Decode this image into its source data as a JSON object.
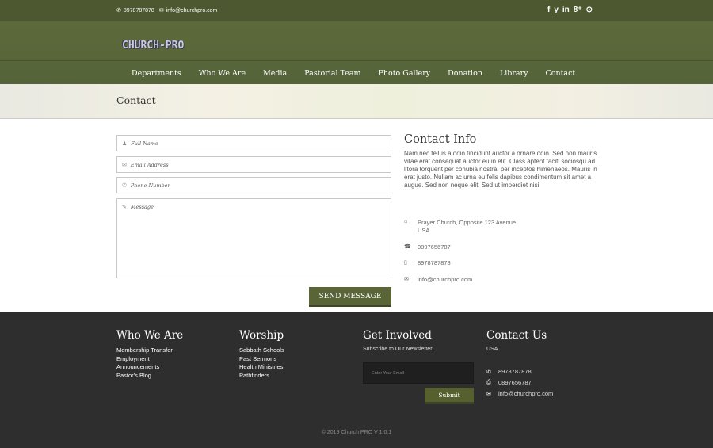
{
  "topbar": {
    "phone": "8978787878",
    "email": "info@churchpro.com",
    "social": [
      {
        "icon": "facebook-icon",
        "glyph": "f"
      },
      {
        "icon": "twitter-icon",
        "glyph": "🐦"
      },
      {
        "icon": "linkedin-icon",
        "glyph": "in"
      },
      {
        "icon": "google-plus-icon",
        "glyph": "g+"
      },
      {
        "icon": "pinterest-icon",
        "glyph": "℗"
      }
    ]
  },
  "header": {
    "logo_text": "CHURCH-PRO",
    "nav": [
      "Departments",
      "Who We Are",
      "Media",
      "Pastorial Team",
      "Photo Gallery",
      "Donation",
      "Library",
      "Contact"
    ]
  },
  "banner": {
    "title": "Contact"
  },
  "form": {
    "full_name_placeholder": "Full Name",
    "email_placeholder": "Email Address",
    "phone_placeholder": "Phone Number",
    "message_placeholder": "Message",
    "send_label": "SEND MESSAGE"
  },
  "contact_info": {
    "title": "Contact Info",
    "description": "Nam nec tellus a odio tincidunt auctor a ornare odio. Sed non mauris vitae erat consequat auctor eu in elit. Class aptent taciti sociosqu ad litora torquent per conubia nostra, per inceptos himenaeos. Mauris in erat justo. Nullam ac urna eu felis dapibus condimentum sit amet a augue. Sed non neque elit. Sed ut imperdiet nisi",
    "address_line1": "Prayer Church, Opposite 123 Avenue",
    "address_line2": "USA",
    "fax": "0897656787",
    "mobile": "8978787878",
    "email": "info@churchpro.com"
  },
  "footer": {
    "who_we_are": {
      "title": "Who We Are",
      "links": [
        "Membership Transfer",
        "Employment",
        "Announcements",
        "Pastor's Blog"
      ]
    },
    "worship": {
      "title": "Worship",
      "links": [
        "Sabbath Schools",
        "Past Sermons",
        "Health Ministries",
        "Pathfinders"
      ]
    },
    "get_involved": {
      "title": "Get Involved",
      "subtitle": "Subscribe to Our Newsletter.",
      "email_placeholder": "Enter Your Email",
      "submit_label": "Submit"
    },
    "contact_us": {
      "title": "Contact Us",
      "country": "USA",
      "phone": "8978787878",
      "fax": "0897656787",
      "email": "info@churchpro.com"
    },
    "copyright": "© 2019 Church PRO V 1.0.1"
  },
  "colors": {
    "brand_green": "#5a6537",
    "topbar": "#4d5730",
    "footer": "#2e2e2e"
  }
}
